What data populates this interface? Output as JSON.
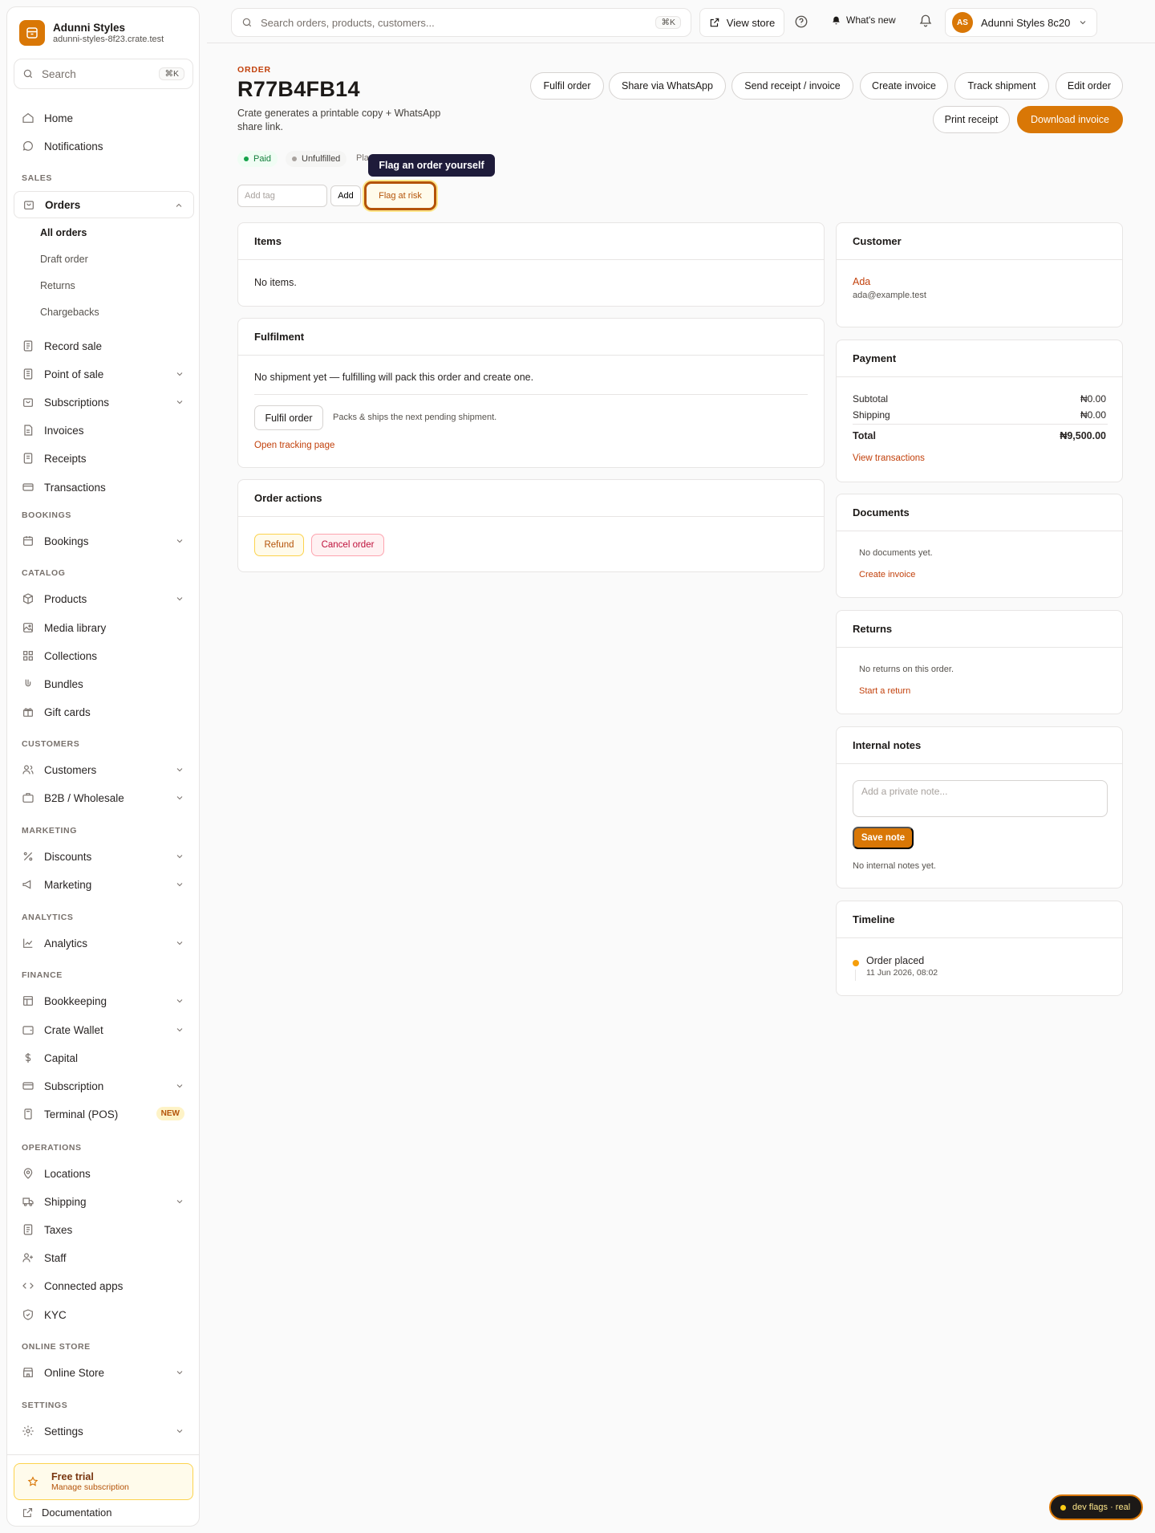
{
  "brand": {
    "name": "Adunni Styles",
    "url": "adunni-styles-8f23.crate.test"
  },
  "sidebar": {
    "search_placeholder": "Search",
    "search_shortcut": "⌘K",
    "top_items": [
      {
        "label": "Home",
        "icon": "home-icon"
      },
      {
        "label": "Notifications",
        "icon": "message-icon"
      }
    ],
    "sections": {
      "sales": "SALES",
      "bookings": "BOOKINGS",
      "catalog": "CATALOG",
      "customers": "CUSTOMERS",
      "marketing": "MARKETING",
      "analytics": "ANALYTICS",
      "finance": "FINANCE",
      "operations": "OPERATIONS",
      "online_store": "ONLINE STORE",
      "settings": "SETTINGS"
    },
    "orders": {
      "label": "Orders",
      "sub": [
        "All orders",
        "Draft order",
        "Returns",
        "Chargebacks"
      ],
      "current": "All orders"
    },
    "items": {
      "record_sale": "Record sale",
      "point_of_sale": "Point of sale",
      "subscriptions": "Subscriptions",
      "invoices": "Invoices",
      "receipts": "Receipts",
      "transactions": "Transactions",
      "bookings": "Bookings",
      "products": "Products",
      "media_library": "Media library",
      "collections": "Collections",
      "bundles": "Bundles",
      "gift_cards": "Gift cards",
      "customers": "Customers",
      "b2b": "B2B / Wholesale",
      "discounts": "Discounts",
      "marketing": "Marketing",
      "analytics": "Analytics",
      "bookkeeping": "Bookkeeping",
      "crate_wallet": "Crate Wallet",
      "capital": "Capital",
      "subscription": "Subscription",
      "terminal": "Terminal (POS)",
      "locations": "Locations",
      "shipping": "Shipping",
      "taxes": "Taxes",
      "staff": "Staff",
      "connected_apps": "Connected apps",
      "kyc": "KYC",
      "online_store": "Online Store",
      "settings": "Settings"
    },
    "new_badge": "NEW",
    "trial": {
      "title": "Free trial",
      "subtitle": "Manage subscription"
    },
    "documentation": "Documentation"
  },
  "topbar": {
    "search_placeholder": "Search orders, products, customers...",
    "search_shortcut": "⌘K",
    "view_store": "View store",
    "whats_new": "What's new",
    "account_initials": "AS",
    "account_name": "Adunni Styles 8c20"
  },
  "order": {
    "eyebrow": "ORDER",
    "id": "R77B4FB14",
    "description": "Crate generates a printable copy + WhatsApp share link.",
    "status_paid": "Paid",
    "status_fulfilment": "Unfulfilled",
    "peek_text": "Pla",
    "tooltip": "Flag an order yourself",
    "tag_placeholder": "Add tag",
    "add_label": "Add",
    "flag_label": "Flag at risk"
  },
  "actions": {
    "fulfil": "Fulfil order",
    "share": "Share via WhatsApp",
    "send": "Send receipt / invoice",
    "create_invoice": "Create invoice",
    "track": "Track shipment",
    "edit": "Edit order",
    "print": "Print receipt",
    "download": "Download invoice"
  },
  "items_card": {
    "title": "Items",
    "empty": "No items."
  },
  "fulfilment_card": {
    "title": "Fulfilment",
    "message": "No shipment yet — fulfilling will pack this order and create one.",
    "button": "Fulfil order",
    "hint": "Packs & ships the next pending shipment.",
    "tracking_link": "Open tracking page"
  },
  "order_actions_card": {
    "title": "Order actions",
    "refund": "Refund",
    "cancel": "Cancel order"
  },
  "customer_card": {
    "title": "Customer",
    "name": "Ada",
    "email": "ada@example.test"
  },
  "payment_card": {
    "title": "Payment",
    "rows": [
      {
        "label": "Subtotal",
        "value": "₦0.00"
      },
      {
        "label": "Shipping",
        "value": "₦0.00"
      }
    ],
    "total_label": "Total",
    "total_value": "₦9,500.00",
    "link": "View transactions"
  },
  "documents_card": {
    "title": "Documents",
    "empty": "No documents yet.",
    "link": "Create invoice"
  },
  "returns_card": {
    "title": "Returns",
    "empty": "No returns on this order.",
    "link": "Start a return"
  },
  "notes_card": {
    "title": "Internal notes",
    "placeholder": "Add a private note...",
    "save": "Save note",
    "empty": "No internal notes yet."
  },
  "timeline_card": {
    "title": "Timeline",
    "event": "Order placed",
    "time": "11 Jun 2026, 08:02"
  },
  "dev_flags": "dev flags · real",
  "colors": {
    "accent": "#d97706",
    "accent_text": "#c2410c",
    "paid": "#16a34a",
    "tooltip_bg": "#1e1b3a"
  }
}
